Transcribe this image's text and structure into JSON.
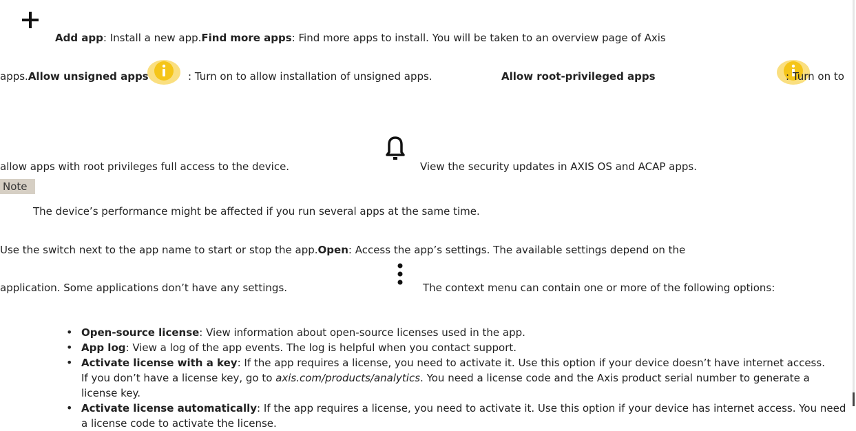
{
  "line1": {
    "add_app_label": "Add app",
    "add_app_text": ": Install a new app.",
    "find_more_label": "Find more apps",
    "find_more_text": ": Find more apps to install. You will be taken to an overview page of Axis"
  },
  "line2": {
    "prefix": "apps.",
    "unsigned_label": "Allow unsigned apps",
    "unsigned_text": ": Turn on to allow installation of unsigned apps.",
    "root_label": "Allow root-privileged apps",
    "root_text": ": Turn on to"
  },
  "line3": {
    "text": "allow apps with root privileges full access to the device.",
    "security_text": "View the security updates in AXIS OS and ACAP apps."
  },
  "note": {
    "label": "Note",
    "text": "The device’s performance might be affected if you run several apps at the same time."
  },
  "line4": {
    "switch_text": "Use the switch next to the app name to start or stop the app.",
    "open_label": "Open",
    "open_text": ": Access the app’s settings. The available settings depend on the"
  },
  "line5": {
    "text": "application. Some applications don’t have any settings.",
    "context_text": "The context menu can contain one or more of the following options:"
  },
  "options": [
    {
      "label": "Open-source license",
      "text": ": View information about open-source licenses used in the app."
    },
    {
      "label": "App log",
      "text": ": View a log of the app events. The log is helpful when you contact support."
    },
    {
      "label": "Activate license with a key",
      "text": ": If the app requires a license, you need to activate it. Use this option if your device doesn’t have internet access.",
      "sub_prefix": "If you don’t have a license key, go to ",
      "sub_link": "axis.com/products/analytics",
      "sub_suffix": ". You need a license code and the Axis product serial number to generate a license key."
    },
    {
      "label": "Activate license automatically",
      "text": ": If the app requires a license, you need to activate it. Use this option if your device has internet access. You need a license code to activate the license."
    }
  ],
  "icons": {
    "add": "plus-icon",
    "info": "info-icon",
    "bell": "bell-icon",
    "menu": "vertical-dots-icon"
  },
  "colors": {
    "info_yellow": "#f5c518",
    "note_bg": "#d6cfc4"
  }
}
